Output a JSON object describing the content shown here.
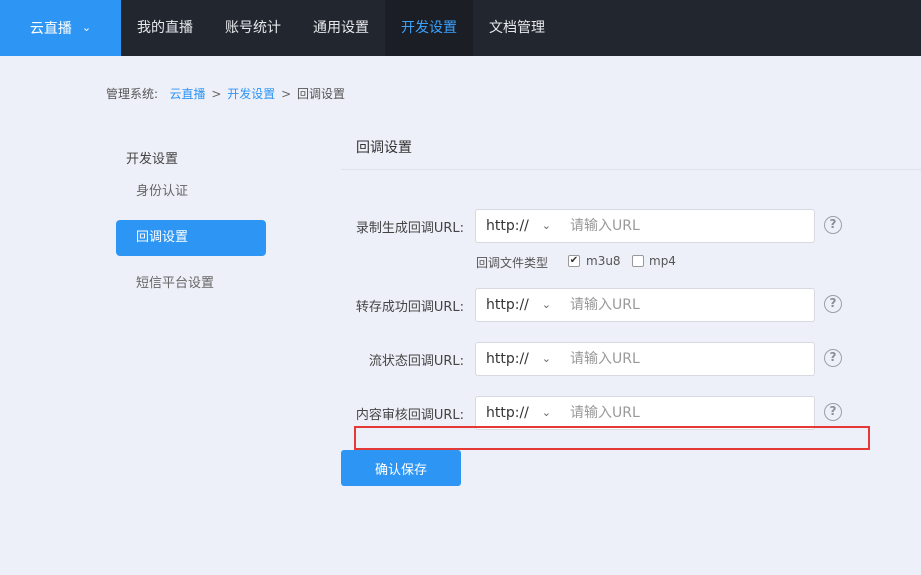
{
  "topbar": {
    "brand": "云直播",
    "nav": [
      "我的直播",
      "账号统计",
      "通用设置",
      "开发设置",
      "文档管理"
    ],
    "active_index": 3
  },
  "breadcrumb": {
    "prefix": "管理系统:",
    "items": [
      "云直播",
      "开发设置",
      "回调设置"
    ],
    "separator": ">"
  },
  "sidebar": {
    "title": "开发设置",
    "items": [
      "身份认证",
      "回调设置",
      "短信平台设置"
    ],
    "active_index": 1
  },
  "content": {
    "title": "回调设置",
    "fields": [
      {
        "label": "录制生成回调URL:",
        "protocol": "http://",
        "placeholder": "请输入URL"
      },
      {
        "label": "转存成功回调URL:",
        "protocol": "http://",
        "placeholder": "请输入URL"
      },
      {
        "label": "流状态回调URL:",
        "protocol": "http://",
        "placeholder": "请输入URL"
      },
      {
        "label": "内容审核回调URL:",
        "protocol": "http://",
        "placeholder": "请输入URL"
      }
    ],
    "filetype": {
      "label": "回调文件类型",
      "options": [
        {
          "label": "m3u8",
          "checked": true
        },
        {
          "label": "mp4",
          "checked": false
        }
      ]
    },
    "save_label": "确认保存",
    "help_glyph": "?"
  },
  "colors": {
    "accent": "#2d95f4",
    "topbar": "#22262e",
    "highlight": "#e53935"
  }
}
